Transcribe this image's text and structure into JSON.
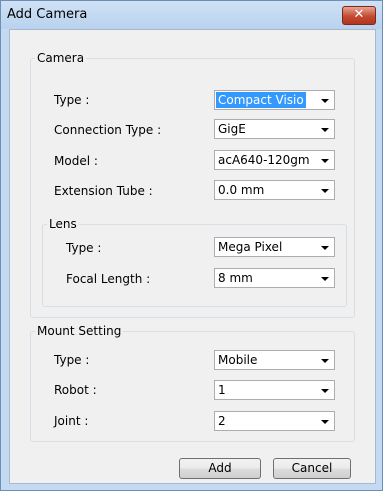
{
  "window": {
    "title": "Add Camera"
  },
  "camera": {
    "legend": "Camera",
    "type": {
      "label": "Type :",
      "value": "Compact Visio"
    },
    "connection_type": {
      "label": "Connection Type :",
      "value": "GigE"
    },
    "model": {
      "label": "Model :",
      "value": "acA640-120gm"
    },
    "extension_tube": {
      "label": "Extension Tube :",
      "value": "0.0 mm"
    }
  },
  "lens": {
    "legend": "Lens",
    "type": {
      "label": "Type :",
      "value": "Mega Pixel"
    },
    "focal_length": {
      "label": "Focal Length :",
      "value": "8 mm"
    }
  },
  "mount": {
    "legend": "Mount Setting",
    "type": {
      "label": "Type :",
      "value": "Mobile"
    },
    "robot": {
      "label": "Robot :",
      "value": "1"
    },
    "joint": {
      "label": "Joint :",
      "value": "2"
    }
  },
  "buttons": {
    "add": "Add",
    "cancel": "Cancel"
  },
  "icons": {
    "close": "close-icon",
    "dropdown": "chevron-down-icon"
  },
  "colors": {
    "selection": "#3399ff",
    "close_button": "#c44a30",
    "frame": "#c4daf2"
  }
}
